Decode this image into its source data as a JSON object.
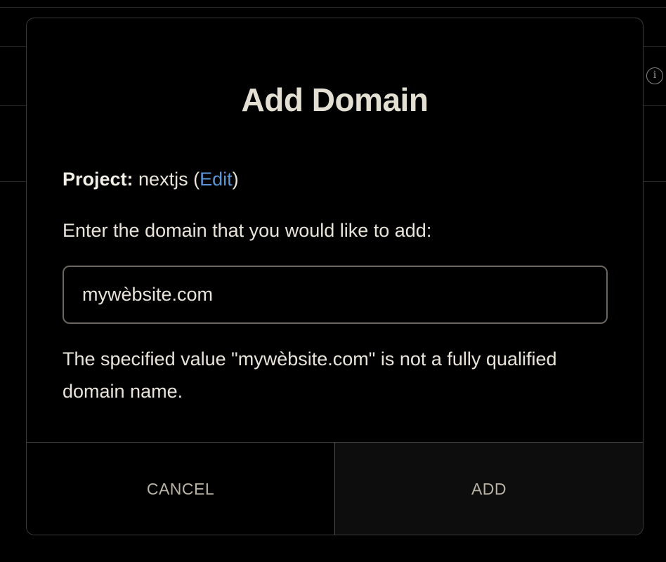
{
  "modal": {
    "title": "Add Domain",
    "project_label": "Project:",
    "project_name": " nextjs (",
    "edit_label": "Edit",
    "project_suffix": ")",
    "prompt": "Enter the domain that you would like to add:",
    "domain_value": "mywèbsite.com",
    "error_message": "The specified value \"mywèbsite.com\" is not a fully qualified domain name.",
    "cancel_label": "CANCEL",
    "add_label": "ADD"
  },
  "background": {
    "info_icon": "i"
  },
  "colors": {
    "link": "#5a96d6",
    "text": "#e8e4da",
    "title": "#e4dfd3",
    "button_text": "#b9b3a6",
    "border": "#6b6760"
  }
}
